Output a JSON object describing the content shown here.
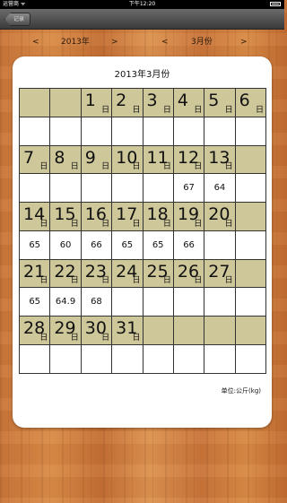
{
  "status_bar": {
    "carrier": "运营商 ᯤ",
    "time": "下午12:20"
  },
  "nav": {
    "back_label": "记录"
  },
  "selector": {
    "prev_year": "<",
    "year": "2013年",
    "next_year": ">",
    "prev_month": "<",
    "month": "3月份",
    "next_month": ">"
  },
  "calendar": {
    "title": "2013年3月份",
    "day_suffix": "日",
    "unit": "单位:公斤(kg)",
    "weeks": [
      [
        null,
        null,
        {
          "day": "1",
          "weight": ""
        },
        {
          "day": "2",
          "weight": ""
        },
        {
          "day": "3",
          "weight": ""
        },
        {
          "day": "4",
          "weight": ""
        },
        {
          "day": "5",
          "weight": ""
        },
        {
          "day": "6",
          "weight": ""
        }
      ],
      [
        {
          "day": "7",
          "weight": ""
        },
        {
          "day": "8",
          "weight": ""
        },
        {
          "day": "9",
          "weight": ""
        },
        {
          "day": "10",
          "weight": ""
        },
        {
          "day": "11",
          "weight": ""
        },
        {
          "day": "12",
          "weight": "67"
        },
        {
          "day": "13",
          "weight": "64"
        },
        null
      ],
      [
        {
          "day": "14",
          "weight": "65"
        },
        {
          "day": "15",
          "weight": "60"
        },
        {
          "day": "16",
          "weight": "66"
        },
        {
          "day": "17",
          "weight": "65"
        },
        {
          "day": "18",
          "weight": "65"
        },
        {
          "day": "19",
          "weight": "66"
        },
        {
          "day": "20",
          "weight": ""
        },
        null
      ],
      [
        {
          "day": "21",
          "weight": "65"
        },
        {
          "day": "22",
          "weight": "64.9"
        },
        {
          "day": "23",
          "weight": "68"
        },
        {
          "day": "24",
          "weight": ""
        },
        {
          "day": "25",
          "weight": ""
        },
        {
          "day": "26",
          "weight": ""
        },
        {
          "day": "27",
          "weight": ""
        },
        null
      ],
      [
        {
          "day": "28",
          "weight": ""
        },
        {
          "day": "29",
          "weight": ""
        },
        {
          "day": "30",
          "weight": ""
        },
        {
          "day": "31",
          "weight": ""
        },
        null,
        null,
        null,
        null
      ]
    ]
  }
}
